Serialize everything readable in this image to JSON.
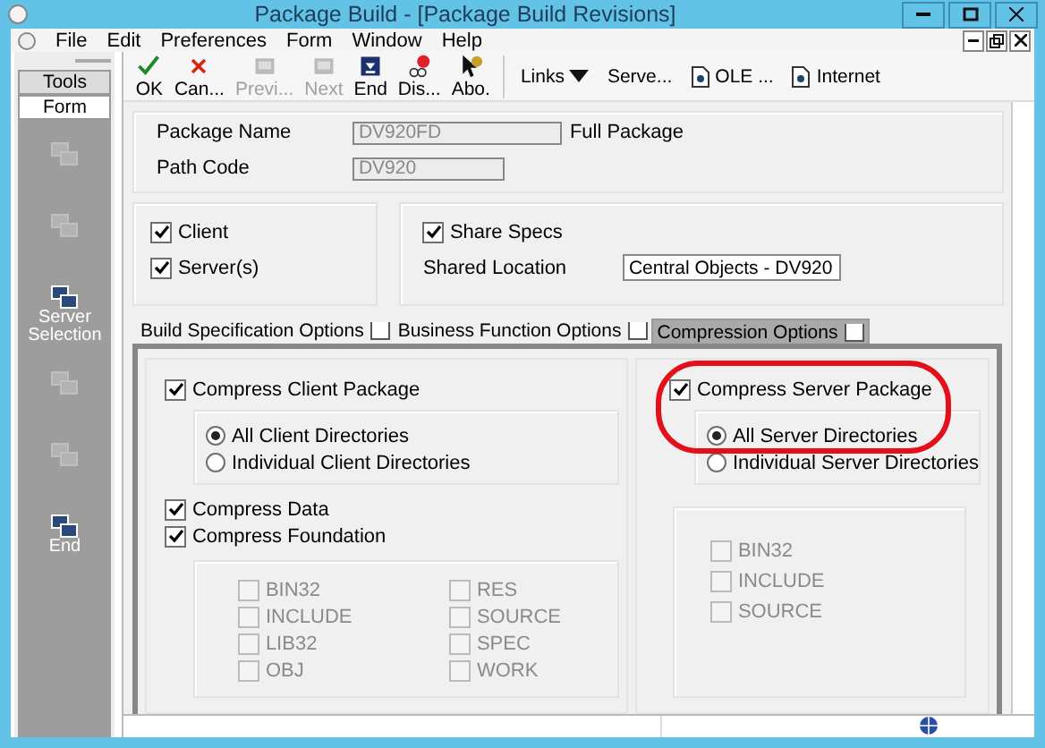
{
  "window": {
    "title": "Package Build - [Package Build Revisions]"
  },
  "menu": [
    "File",
    "Edit",
    "Preferences",
    "Form",
    "Window",
    "Help"
  ],
  "toolbar": [
    {
      "kind": "ok",
      "label": "OK",
      "disabled": false
    },
    {
      "kind": "cancel",
      "label": "Can...",
      "disabled": false
    },
    {
      "kind": "prev",
      "label": "Previ...",
      "disabled": true
    },
    {
      "kind": "next",
      "label": "Next",
      "disabled": true
    },
    {
      "kind": "end",
      "label": "End",
      "disabled": false
    },
    {
      "kind": "errors",
      "label": "Dis...",
      "disabled": false
    },
    {
      "kind": "about",
      "label": "Abo.",
      "disabled": false
    }
  ],
  "links": [
    {
      "kind": "dropdown",
      "label": "Links"
    },
    {
      "kind": "plain",
      "label": "Serve..."
    },
    {
      "kind": "doc",
      "label": "OLE ..."
    },
    {
      "kind": "doc",
      "label": "Internet"
    }
  ],
  "sidebar": {
    "tabs": [
      {
        "label": "Tools",
        "selected": false
      },
      {
        "label": "Form",
        "selected": true
      }
    ],
    "items": [
      {
        "disabled": true
      },
      {
        "disabled": true
      },
      {
        "label": "Server Selection",
        "disabled": false
      },
      {
        "disabled": true
      },
      {
        "disabled": true
      },
      {
        "label": "End",
        "disabled": false
      }
    ]
  },
  "header": {
    "package_name": {
      "label": "Package Name",
      "value": "DV920FD",
      "disabled": true
    },
    "package_type": "Full Package",
    "path_code": {
      "label": "Path Code",
      "value": "DV920",
      "disabled": true
    }
  },
  "targets": [
    {
      "label": "Client",
      "checked": true
    },
    {
      "label": "Server(s)",
      "checked": true
    }
  ],
  "share_specs": {
    "label": "Share Specs",
    "checked": true
  },
  "shared_location": {
    "label": "Shared Location",
    "value": "Central Objects - DV920"
  },
  "tabs": [
    {
      "label": "Build Specification Options",
      "selected": false
    },
    {
      "label": "Business Function Options",
      "selected": false
    },
    {
      "label": "Compression Options",
      "selected": true
    }
  ],
  "client": {
    "compress": {
      "label": "Compress Client Package",
      "checked": true
    },
    "directories": [
      {
        "label": "All Client Directories",
        "selected": true
      },
      {
        "label": "Individual Client Directories",
        "selected": false
      }
    ],
    "options": [
      {
        "label": "Compress Data",
        "checked": true
      },
      {
        "label": "Compress Foundation",
        "checked": true
      }
    ],
    "folders": [
      {
        "label": "BIN32",
        "checked": false
      },
      {
        "label": "INCLUDE",
        "checked": false
      },
      {
        "label": "LIB32",
        "checked": false
      },
      {
        "label": "OBJ",
        "checked": false
      },
      {
        "label": "RES",
        "checked": false
      },
      {
        "label": "SOURCE",
        "checked": false
      },
      {
        "label": "SPEC",
        "checked": false
      },
      {
        "label": "WORK",
        "checked": false
      }
    ]
  },
  "server": {
    "compress": {
      "label": "Compress Server Package",
      "checked": true
    },
    "directories": [
      {
        "label": "All Server Directories",
        "selected": true
      },
      {
        "label": "Individual Server Directories",
        "selected": false
      }
    ],
    "folders": [
      {
        "label": "BIN32",
        "checked": false
      },
      {
        "label": "INCLUDE",
        "checked": false
      },
      {
        "label": "SOURCE",
        "checked": false
      }
    ]
  },
  "annotation": {
    "kind": "ellipse",
    "color": "#e3101c"
  }
}
